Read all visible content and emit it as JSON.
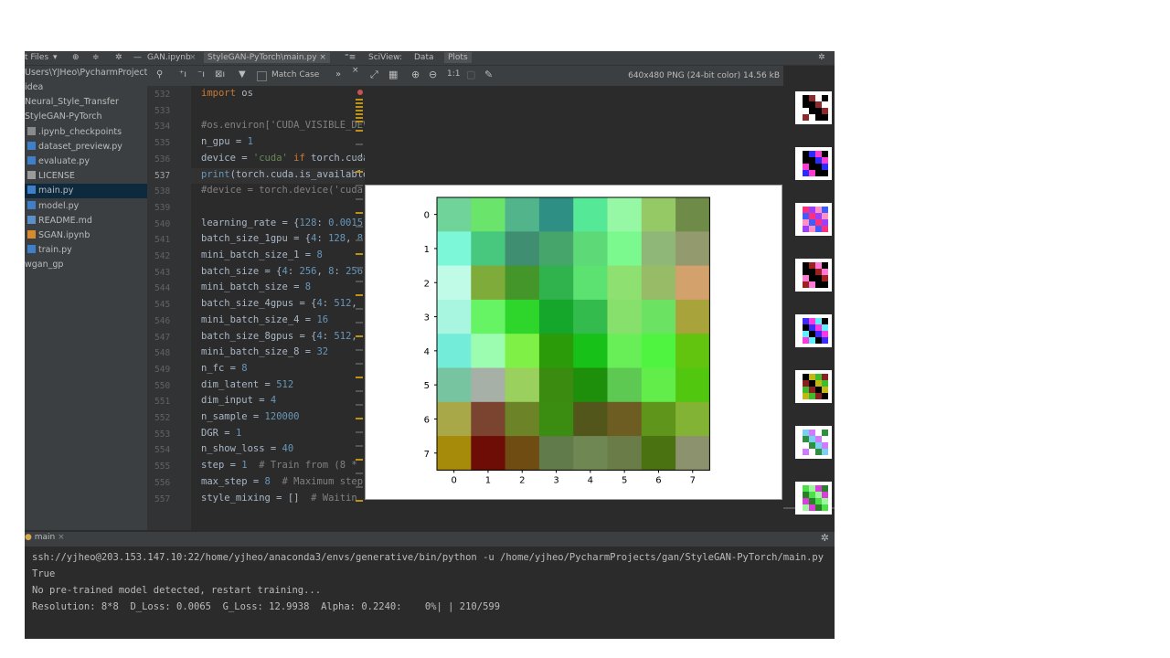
{
  "tabs": {
    "project_files": "t Files",
    "tab1": "GAN.ipynb",
    "tab2": "StyleGAN-PyTorch\\main.py",
    "sciview": "SciView:",
    "data": "Data",
    "plots": "Plots"
  },
  "project": {
    "root": "Users\\YJHeo\\PycharmProject",
    "items": [
      {
        "label": "idea",
        "indent": 0,
        "type": "folder"
      },
      {
        "label": "Neural_Style_Transfer",
        "indent": 0,
        "type": "folder"
      },
      {
        "label": "StyleGAN-PyTorch",
        "indent": 0,
        "type": "folder"
      },
      {
        "label": ".ipynb_checkpoints",
        "indent": 1,
        "type": "folder"
      },
      {
        "label": "dataset_preview.py",
        "indent": 1,
        "type": "py"
      },
      {
        "label": "evaluate.py",
        "indent": 1,
        "type": "py"
      },
      {
        "label": "LICENSE",
        "indent": 1,
        "type": "file"
      },
      {
        "label": "main.py",
        "indent": 1,
        "type": "py",
        "selected": true
      },
      {
        "label": "model.py",
        "indent": 1,
        "type": "py"
      },
      {
        "label": "README.md",
        "indent": 1,
        "type": "md"
      },
      {
        "label": "SGAN.ipynb",
        "indent": 1,
        "type": "nb"
      },
      {
        "label": "train.py",
        "indent": 1,
        "type": "py"
      },
      {
        "label": "wgan_gp",
        "indent": 0,
        "type": "folder"
      }
    ]
  },
  "editor": {
    "match_case": "Match Case",
    "current_line": 537,
    "lines": [
      {
        "n": 532,
        "html": "<span class='kw'>import</span> os"
      },
      {
        "n": 533,
        "html": ""
      },
      {
        "n": 534,
        "html": "<span class='cm'>#os.environ['CUDA_VISIBLE_DEV</span>"
      },
      {
        "n": 535,
        "html": "n_gpu = <span class='num'>1</span>"
      },
      {
        "n": 536,
        "html": "device = <span class='str'>'cuda'</span> <span class='kw'>if</span> torch.cuda"
      },
      {
        "n": 537,
        "html": "<span class='num'>print</span>(torch.cuda.is_available"
      },
      {
        "n": 538,
        "html": "<span class='cm'>#device = torch.device('cuda</span>"
      },
      {
        "n": 539,
        "html": ""
      },
      {
        "n": 540,
        "html": "learning_rate = {<span class='num'>128</span>: <span class='num'>0.0015</span>,"
      },
      {
        "n": 541,
        "html": "batch_size_1gpu = {<span class='num'>4</span>: <span class='num'>128</span>, <span class='num'>8</span>:"
      },
      {
        "n": 542,
        "html": "mini_batch_size_1 = <span class='num'>8</span>"
      },
      {
        "n": 543,
        "html": "batch_size = {<span class='num'>4</span>: <span class='num'>256</span>, <span class='num'>8</span>: <span class='num'>256</span>,"
      },
      {
        "n": 544,
        "html": "mini_batch_size = <span class='num'>8</span>"
      },
      {
        "n": 545,
        "html": "batch_size_4gpus = {<span class='num'>4</span>: <span class='num'>512</span>,"
      },
      {
        "n": 546,
        "html": "mini_batch_size_4 = <span class='num'>16</span>"
      },
      {
        "n": 547,
        "html": "batch_size_8gpus = {<span class='num'>4</span>: <span class='num'>512</span>,"
      },
      {
        "n": 548,
        "html": "mini_batch_size_8 = <span class='num'>32</span>"
      },
      {
        "n": 549,
        "html": "n_fc = <span class='num'>8</span>"
      },
      {
        "n": 550,
        "html": "dim_latent = <span class='num'>512</span>"
      },
      {
        "n": 551,
        "html": "dim_input = <span class='num'>4</span>"
      },
      {
        "n": 552,
        "html": "n_sample = <span class='num'>120000</span>"
      },
      {
        "n": 553,
        "html": "DGR = <span class='num'>1</span>"
      },
      {
        "n": 554,
        "html": "n_show_loss = <span class='num'>40</span>"
      },
      {
        "n": 555,
        "html": "step = <span class='num'>1</span>  <span class='cm'># Train from (8 *</span>"
      },
      {
        "n": 556,
        "html": "max_step = <span class='num'>8</span>  <span class='cm'># Maximum step</span>"
      },
      {
        "n": 557,
        "html": "style_mixing = []  <span class='cm'># Waitin</span>"
      }
    ]
  },
  "sciview": {
    "image_info": "640x480 PNG (24-bit color) 14.56 kB",
    "zoom_label": "1:1"
  },
  "chart_data": {
    "type": "heatmap",
    "x_ticks": [
      "0",
      "1",
      "2",
      "3",
      "4",
      "5",
      "6",
      "7"
    ],
    "y_ticks": [
      "0",
      "1",
      "2",
      "3",
      "4",
      "5",
      "6",
      "7"
    ],
    "cells": [
      [
        "#6fd39a",
        "#6ae46a",
        "#52b48a",
        "#2e8f85",
        "#55e896",
        "#96f7a4",
        "#94c965",
        "#6e8b48"
      ],
      [
        "#7cf8d8",
        "#48c87e",
        "#3f8e72",
        "#46a56a",
        "#5dd978",
        "#7cf98e",
        "#8fb878",
        "#929a6e"
      ],
      [
        "#c0fbe8",
        "#7eab3a",
        "#45962a",
        "#30b24c",
        "#5ce270",
        "#8ee070",
        "#98bb68",
        "#d2a16c"
      ],
      [
        "#a8f6e0",
        "#66f465",
        "#2ed62c",
        "#14a72b",
        "#33bb4e",
        "#88e06c",
        "#6ce262",
        "#a8a33a"
      ],
      [
        "#74ecda",
        "#9cfdb0",
        "#7ff146",
        "#2c9b09",
        "#17c117",
        "#68ef58",
        "#4ff441",
        "#62c40e"
      ],
      [
        "#76c5a0",
        "#a7b0a6",
        "#9ad05e",
        "#3a8b0f",
        "#1d8f0b",
        "#5dc952",
        "#62ed4a",
        "#52c70f"
      ],
      [
        "#a8a848",
        "#7a4430",
        "#6c8427",
        "#3a8d10",
        "#52561a",
        "#6e5d22",
        "#5f951a",
        "#82b335"
      ],
      [
        "#a68a0a",
        "#6e0d06",
        "#6e4c12",
        "#617b4b",
        "#6f8752",
        "#6a7d48",
        "#4a7210",
        "#8c926e"
      ]
    ]
  },
  "console": {
    "tab_label": "main",
    "lines": [
      "ssh://yjheo@203.153.147.10:22/home/yjheo/anaconda3/envs/generative/bin/python -u /home/yjheo/PycharmProjects/gan/StyleGAN-PyTorch/main.py",
      "True",
      "No pre-trained model detected, restart training...",
      "Resolution: 8*8  D_Loss: 0.0065  G_Loss: 12.9938  Alpha: 0.2240:    0%| | 210/599"
    ]
  }
}
